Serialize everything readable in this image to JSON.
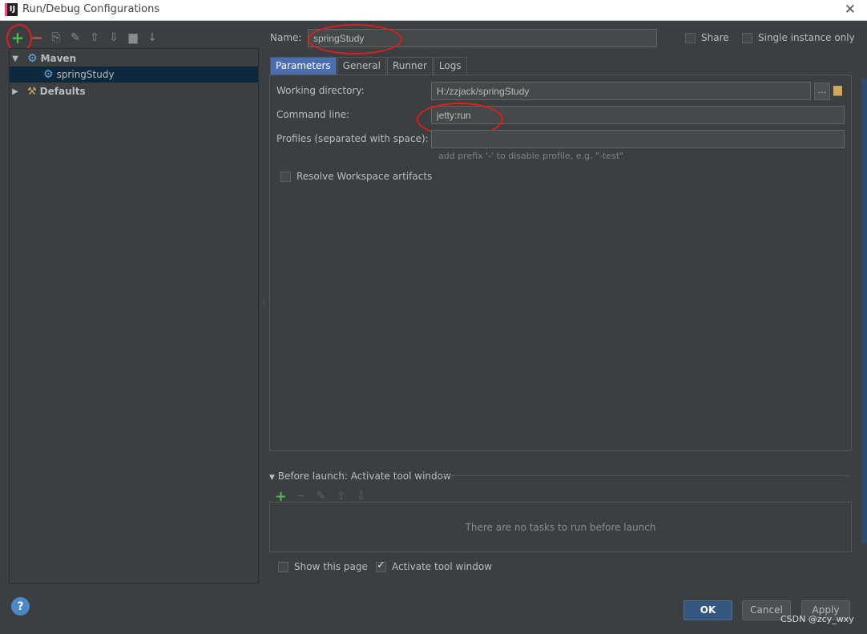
{
  "window": {
    "title": "Run/Debug Configurations",
    "close_label": "✕",
    "app_icon_label": "IJ"
  },
  "toolbar": {
    "add": "+",
    "remove": "−",
    "copy": "⎘",
    "edit_defaults": "✎",
    "move_up": "⇧",
    "move_down": "⇩",
    "folder": "▆",
    "sort": "↓"
  },
  "tree": {
    "items": [
      {
        "label": "Maven",
        "arrow": "▼",
        "icon": "maven-gear-icon"
      },
      {
        "label": "springStudy",
        "icon": "maven-gear-icon"
      },
      {
        "label": "Defaults",
        "arrow": "▶",
        "icon": "defaults-tools-icon"
      }
    ]
  },
  "form": {
    "name_label": "Name:",
    "name_value": "springStudy",
    "share_label": "Share",
    "single_instance_label": "Single instance only",
    "tabs": [
      "Parameters",
      "General",
      "Runner",
      "Logs"
    ],
    "working_dir_label": "Working directory:",
    "working_dir_value": "H:/zzjack/springStudy",
    "command_line_label": "Command line:",
    "command_line_value": "jetty:run",
    "profiles_label": "Profiles (separated with space):",
    "profiles_value": "",
    "profiles_hint": "add prefix '-' to disable profile, e.g. \"-test\"",
    "resolve_label": "Resolve Workspace artifacts",
    "browse_label": "..."
  },
  "before_launch": {
    "header": "Before launch: Activate tool window",
    "empty_text": "There are no tasks to run before launch",
    "show_page_label": "Show this page",
    "activate_label": "Activate tool window"
  },
  "buttons": {
    "ok": "OK",
    "cancel": "Cancel",
    "apply": "Apply",
    "help": "?"
  },
  "watermark": "CSDN @zcy_wxy",
  "colors": {
    "background": "#3c3f41",
    "selection": "#0d293e",
    "accent": "#4b6eaf",
    "annotation": "#e31c1c"
  }
}
